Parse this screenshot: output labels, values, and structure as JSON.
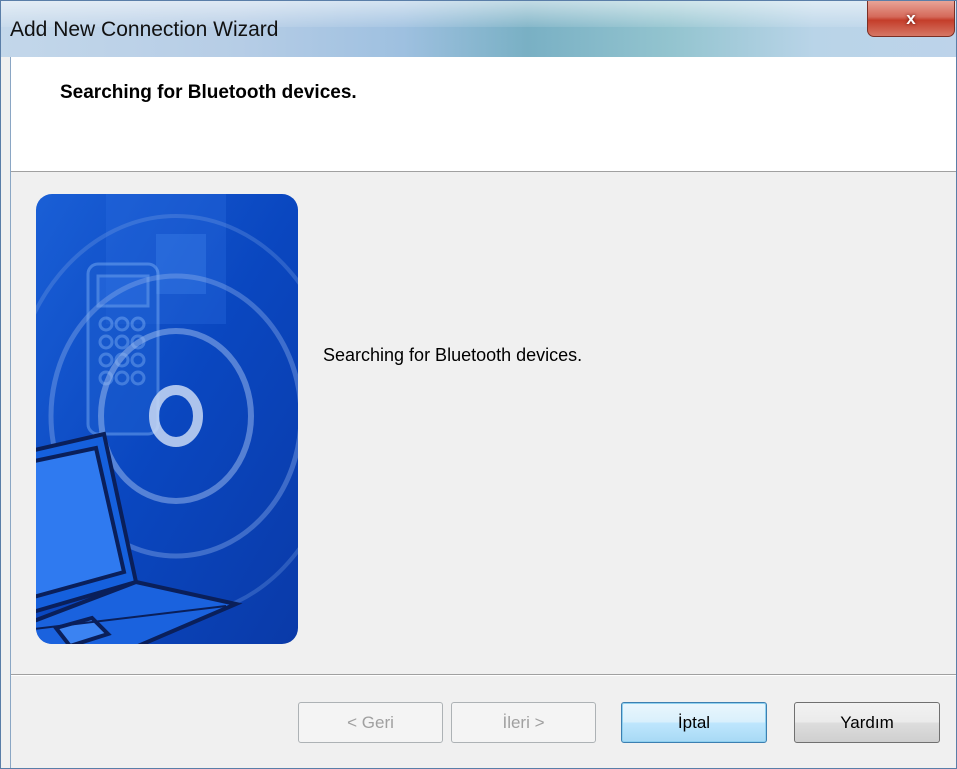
{
  "window": {
    "title": "Add New Connection Wizard",
    "close_glyph": "x"
  },
  "header": {
    "title": "Searching for Bluetooth devices."
  },
  "main": {
    "status_text": "Searching for Bluetooth devices.",
    "image_icon": "bluetooth-wizard-illustration"
  },
  "buttons": {
    "back_label": "< Geri",
    "next_label": "İleri >",
    "cancel_label": "İptal",
    "help_label": "Yardım"
  },
  "colors": {
    "illustration_blue": "#0a4fc4",
    "default_button_border": "#3c7fb1"
  }
}
